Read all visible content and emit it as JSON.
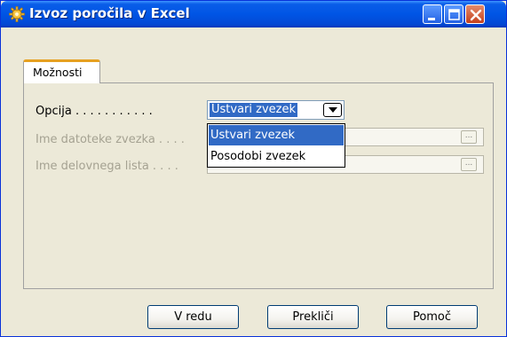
{
  "window": {
    "title": "Izvoz poročila v Excel",
    "icon": "gear-icon",
    "title_buttons": [
      "minimize-icon",
      "maximize-icon",
      "close-icon"
    ]
  },
  "tabs": [
    {
      "label": "Možnosti",
      "active": true
    }
  ],
  "form": {
    "option": {
      "label": "Opcija . . . . . . . . . . .",
      "value": "Ustvari zvezek",
      "options": [
        "Ustvari zvezek",
        "Posodobi zvezek"
      ],
      "highlighted_index": 0
    },
    "file_name": {
      "label": "Ime datoteke zvezka . . . .",
      "value": "",
      "disabled": true,
      "assist_label": "..."
    },
    "sheet_name": {
      "label": "Ime delovnega lista . . . .",
      "value": "",
      "disabled": true,
      "assist_label": "..."
    }
  },
  "buttons": {
    "ok": "V redu",
    "cancel": "Prekliči",
    "help": "Pomoč"
  },
  "colors": {
    "titlebar": "#0055e5",
    "selection": "#316ac5",
    "tab_accent": "#e6a020",
    "dialog_bg": "#ece9d8"
  }
}
